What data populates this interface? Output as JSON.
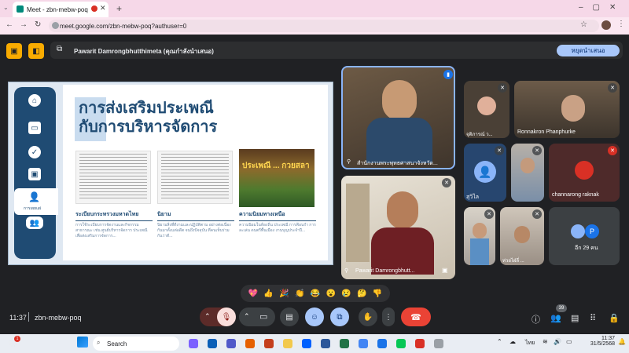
{
  "browser": {
    "tab_title": "Meet - zbn-mebw-poq",
    "url": "meet.google.com/zbn-mebw-poq?authuser=0",
    "new_tab": "+"
  },
  "presenting": {
    "text": "Pawarit Damrongbhutthimeta (คุณกำลังนำเสนอ)",
    "stop_label": "หยุดนำเสนอ"
  },
  "slide": {
    "title_line1": "การส่งเสริมประเพณี",
    "title_line2": "กับการบริหารจัดการ",
    "sidebar_label": "การเผยแผ่",
    "image_text": "ประเพณี ... กวยสลา",
    "sections": [
      {
        "heading": "ระเบียบกระทรวงมหาดไทย",
        "body": "การใช้ระเบียบการจัดงานและกิจกรรม สาธารณะ เช่น ศูนย์บริหารจัดการ ประเพณี เพื่อส่งเสริมการจัดการ..."
      },
      {
        "heading": "นิยาม",
        "body": "นิยามสิ่งที่ดีงามและปฏิบัติตาม อย่างต่อเนื่องกันมาตั้งแต่อดีต จนถึงปัจจุบัน ที่คนเห็นร่วมกันว่าดี..."
      },
      {
        "heading": "ความนิยมทางเหนือ",
        "body": "ความนิยมในท้องถิ่น ประเพณี การฟ้อนรำ การละเล่น ดนตรีพื้นเมือง งานบุญประจำปี..."
      }
    ]
  },
  "participants": {
    "speaker_tile": "สำนักงานพระพุทธศาสนาจังหวัด...",
    "self_tile": "Pawarit Damrongbhutt...",
    "tiles": [
      {
        "name": "จุติภารณ์ ว..."
      },
      {
        "name": "Ronnakron Phanphurke"
      },
      {
        "name": "สุวิไล"
      },
      {
        "name": "channarong raknak"
      },
      {
        "name": "ห่วยไฝ่ลี่ ..."
      },
      {
        "name": "อีก 29 คน",
        "avatar": "P"
      }
    ]
  },
  "meeting": {
    "time": "11:37",
    "code": "zbn-mebw-poq",
    "participant_count": "39"
  },
  "reactions": [
    "💖",
    "👍",
    "🎉",
    "👏",
    "😂",
    "😮",
    "😢",
    "🤔",
    "👎"
  ],
  "taskbar": {
    "search": "Search",
    "badge": "1",
    "lang": "ไทย",
    "clock_time": "11:37",
    "clock_date": "31/5/2568"
  },
  "colors": {
    "meet_bg": "#202124",
    "accent_blue": "#a8c7fa",
    "end_call_red": "#ea4335",
    "slide_navy": "#1f4b73"
  }
}
